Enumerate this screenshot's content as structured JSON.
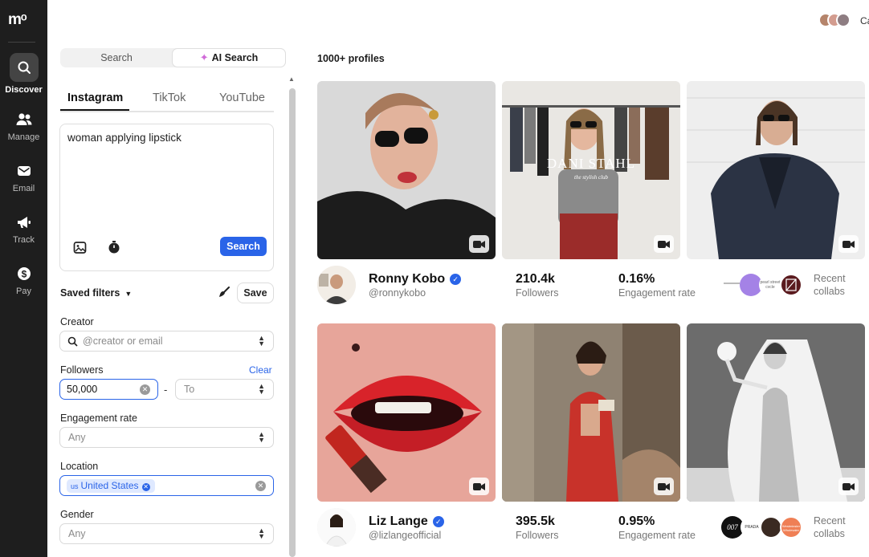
{
  "app": {
    "logo": "mᵒ"
  },
  "nav": [
    {
      "label": "Discover",
      "icon": "search-icon"
    },
    {
      "label": "Manage",
      "icon": "users-icon"
    },
    {
      "label": "Email",
      "icon": "mail-icon"
    },
    {
      "label": "Track",
      "icon": "megaphone-icon"
    },
    {
      "label": "Pay",
      "icon": "dollar-icon"
    }
  ],
  "search_mode": {
    "search_label": "Search",
    "ai_label": "AI Search",
    "selected": "AI Search"
  },
  "platform_tabs": [
    "Instagram",
    "TikTok",
    "YouTube"
  ],
  "ai_query": {
    "value": "woman applying lipstick",
    "button_label": "Search"
  },
  "saved_filters": {
    "label": "Saved filters",
    "save_label": "Save"
  },
  "filters": {
    "creator": {
      "label": "Creator",
      "placeholder": "@creator or email"
    },
    "followers": {
      "label": "Followers",
      "clear_label": "Clear",
      "from_value": "50,000",
      "to_placeholder": "To"
    },
    "engagement": {
      "label": "Engagement rate",
      "placeholder": "Any"
    },
    "location": {
      "label": "Location",
      "chip_code": "us",
      "chip_label": "United States"
    },
    "gender": {
      "label": "Gender",
      "placeholder": "Any"
    }
  },
  "results": {
    "count_label": "1000+ profiles",
    "user_truncated": "Ca"
  },
  "profiles": [
    {
      "name": "Ronny Kobo",
      "handle": "@ronnykobo",
      "followers": "210.4k",
      "followers_label": "Followers",
      "engagement": "0.16%",
      "engagement_label": "Engagement rate",
      "recent_label_1": "Recent",
      "recent_label_2": "collabs",
      "overlay_title": "DANI STAHL",
      "overlay_sub": "the stylish club",
      "brand_text": "pearl street cvcle"
    },
    {
      "name": "Liz Lange",
      "handle": "@lizlangeofficial",
      "followers": "395.5k",
      "followers_label": "Followers",
      "engagement": "0.95%",
      "engagement_label": "Engagement rate",
      "recent_label_1": "Recent",
      "recent_label_2": "collabs",
      "brand_logo_1": "007",
      "brand_text": "PRADA",
      "brand_logo_3": "Westminster Wholesaler"
    }
  ]
}
